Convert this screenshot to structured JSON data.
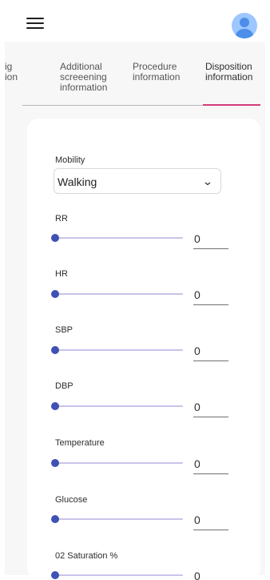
{
  "topbar": {
    "menu_icon": "menu-icon",
    "avatar_icon": "user-avatar-icon"
  },
  "tabs": [
    {
      "label": "ig\nion"
    },
    {
      "label": "Additional\nscreeening\ninformation"
    },
    {
      "label": "Procedure\ninformation"
    },
    {
      "label": "Disposition\ninformation",
      "active": true
    }
  ],
  "form": {
    "mobility": {
      "label": "Mobility",
      "value": "Walking"
    },
    "fields": [
      {
        "label": "RR",
        "value": "0"
      },
      {
        "label": "HR",
        "value": "0"
      },
      {
        "label": "SBP",
        "value": "0"
      },
      {
        "label": "DBP",
        "value": "0"
      },
      {
        "label": "Temperature",
        "value": "0"
      },
      {
        "label": "Glucose",
        "value": "0"
      },
      {
        "label": "02 Saturation %",
        "value": "0"
      }
    ]
  },
  "colors": {
    "accent": "#3f51b5",
    "tab_active": "#d23c7a",
    "track": "#c8c4e8"
  }
}
